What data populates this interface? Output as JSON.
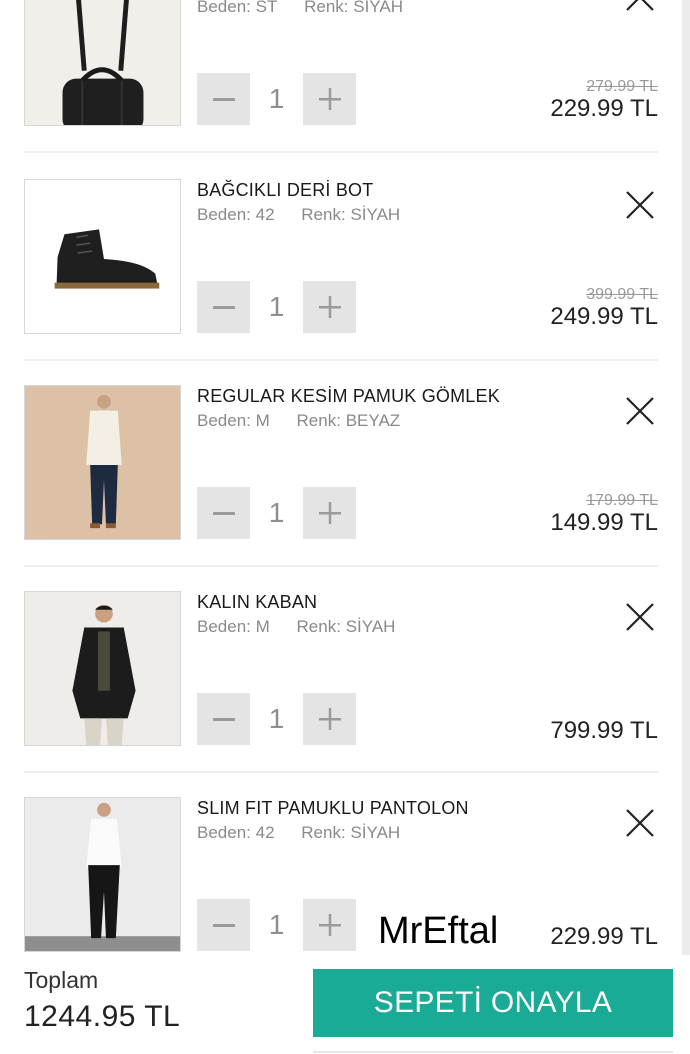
{
  "cart": {
    "size_label": "Beden:",
    "color_label": "Renk:",
    "items": [
      {
        "title": "",
        "size": "ST",
        "color": "SIYAH",
        "qty": "1",
        "old_price": "279.99 TL",
        "price": "229.99 TL",
        "image": "duffel-bag"
      },
      {
        "title": "BAĞCIKLI DERİ BOT",
        "size": "42",
        "color": "SİYAH",
        "qty": "1",
        "old_price": "399.99 TL",
        "price": "249.99 TL",
        "image": "leather-boot"
      },
      {
        "title": "REGULAR KESİM PAMUK GÖMLEK",
        "size": "M",
        "color": "BEYAZ",
        "qty": "1",
        "old_price": "179.99 TL",
        "price": "149.99 TL",
        "image": "man-white-shirt"
      },
      {
        "title": "KALIN KABAN",
        "size": "M",
        "color": "SİYAH",
        "qty": "1",
        "old_price": "",
        "price": "799.99 TL",
        "image": "man-black-coat"
      },
      {
        "title": "SLIM FIT PAMUKLU PANTOLON",
        "size": "42",
        "color": "SİYAH",
        "qty": "1",
        "old_price": "",
        "price": "229.99 TL",
        "image": "man-trousers"
      }
    ]
  },
  "watermark": "MrEftal",
  "footer": {
    "total_label": "Toplam",
    "total_value": "1244.95 TL",
    "confirm_label": "SEPETİ ONAYLA"
  },
  "colors": {
    "accent": "#1aab96",
    "stepper": "#e4e4e4",
    "muted": "#8a8a8a"
  }
}
